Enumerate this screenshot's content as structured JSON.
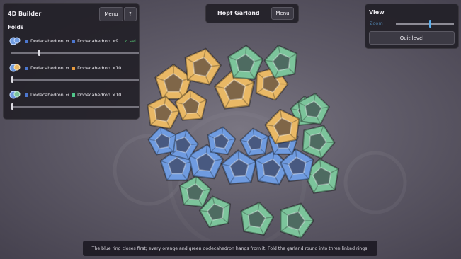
{
  "builder": {
    "title": "4D Builder",
    "menu_label": "Menu",
    "help_label": "?",
    "folds_label": "Folds",
    "folds": [
      {
        "left": "Dodecahedron",
        "arrow": "↔",
        "right": "Dodecahedron ×9",
        "status": "✓ set",
        "left_color": "#4c77cf",
        "right_color": "#4c77cf",
        "slider": 0.2
      },
      {
        "left": "Dodecahedron",
        "arrow": "↔",
        "right": "Dodecahedron ×10",
        "status": "",
        "left_color": "#4c77cf",
        "right_color": "#e79a3d",
        "slider": 0.0
      },
      {
        "left": "Dodecahedron",
        "arrow": "↔",
        "right": "Dodecahedron ×10",
        "status": "",
        "left_color": "#4c77cf",
        "right_color": "#4fc68a",
        "slider": 0.0
      }
    ]
  },
  "level": {
    "title": "Hopf Garland",
    "menu_label": "Menu"
  },
  "view": {
    "title": "View",
    "zoom_label": "Zoom",
    "zoom_value": 0.6,
    "quit_label": "Quit level"
  },
  "caption": "The blue ring closes first; every orange and green dodecahedron hangs from it. Fold the garland round into three linked rings.",
  "colors": {
    "blue": "#6f9be0",
    "orange": "#e9b865",
    "green": "#7cc49b",
    "accent": "#5ab0f0"
  }
}
